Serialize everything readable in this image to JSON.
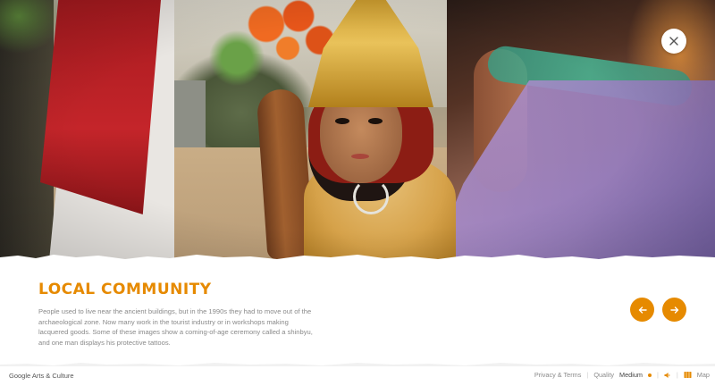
{
  "colors": {
    "accent": "#e68a00",
    "body_text": "#8a8a8a",
    "background": "#ffffff"
  },
  "hero": {
    "alt_icon": "close-icon"
  },
  "section": {
    "title": "LOCAL COMMUNITY",
    "body": "People used to live near the ancient buildings, but in the 1990s they had to move out of the archaeological zone. Now many work in the tourist industry or in workshops making lacquered goods. Some of these images show a coming-of-age ceremony called a shinbyu, and one man displays his protective tattoos."
  },
  "nav": {
    "prev_icon": "arrow-left-icon",
    "next_icon": "arrow-right-icon"
  },
  "footer": {
    "brand": "Google Arts & Culture",
    "privacy": "Privacy & Terms",
    "quality_label": "Quality",
    "quality_value": "Medium",
    "map_label": "Map"
  }
}
